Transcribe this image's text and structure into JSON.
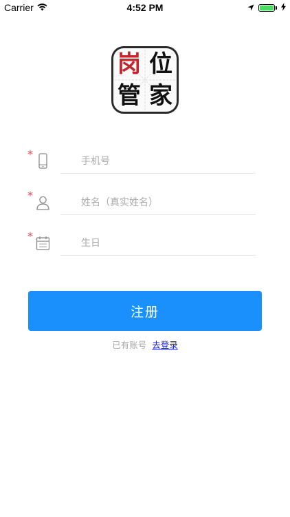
{
  "status_bar": {
    "carrier": "Carrier",
    "time": "4:52 PM",
    "battery_level": 1.0,
    "icons": [
      "wifi-icon",
      "location-arrow-icon",
      "battery-icon",
      "charging-bolt-icon"
    ]
  },
  "logo": {
    "chars": [
      "岗",
      "位",
      "管",
      "家"
    ],
    "accent_color": "#c0262c"
  },
  "form": {
    "phone_placeholder": "手机号",
    "name_placeholder": "姓名（真实姓名）",
    "birthday_placeholder": "生日",
    "required_mark": "*"
  },
  "actions": {
    "register_label": "注册",
    "has_account_text": "已有账号",
    "login_link_label": "去登录"
  },
  "colors": {
    "primary": "#1990fb",
    "required": "#e8464d",
    "link": "#1a20d9"
  }
}
